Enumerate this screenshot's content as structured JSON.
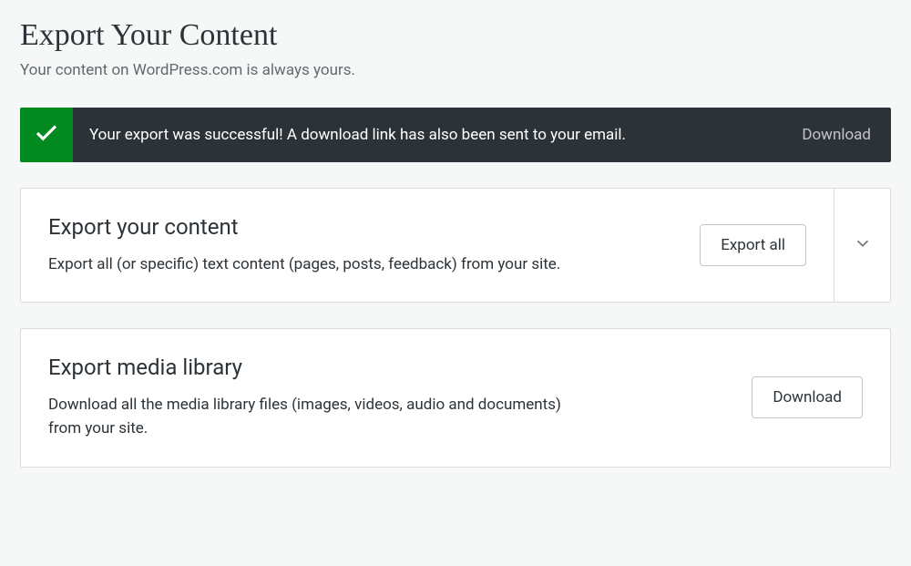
{
  "header": {
    "title": "Export Your Content",
    "subtitle": "Your content on WordPress.com is always yours."
  },
  "notice": {
    "message": "Your export was successful! A download link has also been sent to your email.",
    "action_label": "Download"
  },
  "sections": {
    "content": {
      "title": "Export your content",
      "description": "Export all (or specific) text content (pages, posts, feedback) from your site.",
      "button_label": "Export all"
    },
    "media": {
      "title": "Export media library",
      "description": "Download all the media library files (images, videos, audio and documents) from your site.",
      "button_label": "Download"
    }
  }
}
